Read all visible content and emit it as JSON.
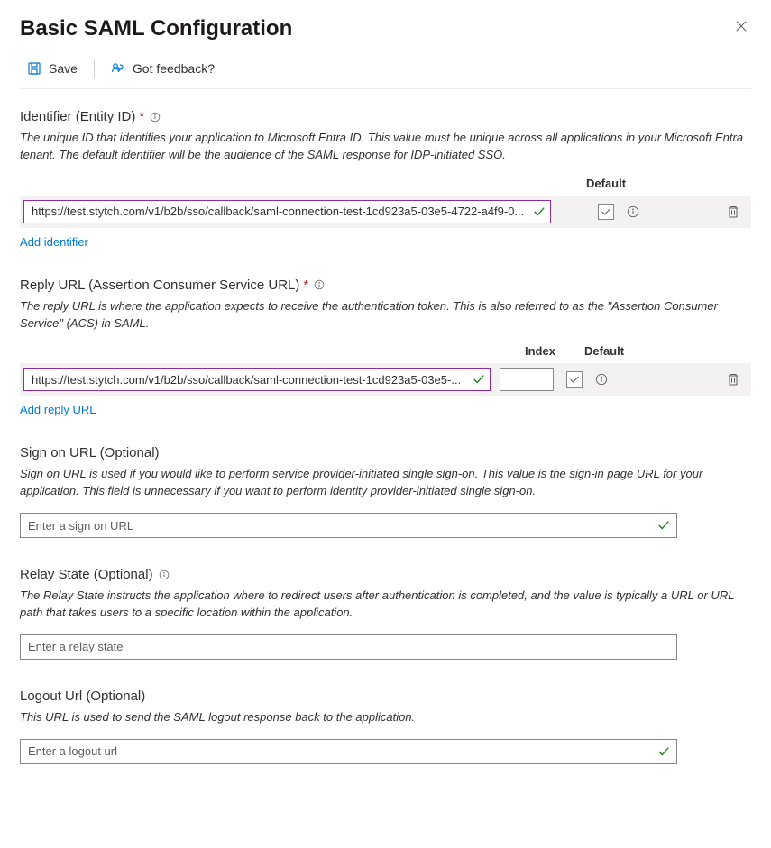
{
  "header": {
    "title": "Basic SAML Configuration"
  },
  "toolbar": {
    "save_label": "Save",
    "feedback_label": "Got feedback?"
  },
  "columns": {
    "index": "Index",
    "default": "Default"
  },
  "identifier": {
    "label": "Identifier (Entity ID)",
    "required_marker": "*",
    "description": "The unique ID that identifies your application to Microsoft Entra ID. This value must be unique across all applications in your Microsoft Entra tenant. The default identifier will be the audience of the SAML response for IDP-initiated SSO.",
    "value": "https://test.stytch.com/v1/b2b/sso/callback/saml-connection-test-1cd923a5-03e5-4722-a4f9-0...",
    "add_link": "Add identifier"
  },
  "reply_url": {
    "label": "Reply URL (Assertion Consumer Service URL)",
    "required_marker": "*",
    "description": "The reply URL is where the application expects to receive the authentication token. This is also referred to as the \"Assertion Consumer Service\" (ACS) in SAML.",
    "value": "https://test.stytch.com/v1/b2b/sso/callback/saml-connection-test-1cd923a5-03e5-...",
    "index_value": "",
    "add_link": "Add reply URL"
  },
  "sign_on": {
    "label": "Sign on URL (Optional)",
    "description": "Sign on URL is used if you would like to perform service provider-initiated single sign-on. This value is the sign-in page URL for your application. This field is unnecessary if you want to perform identity provider-initiated single sign-on.",
    "placeholder": "Enter a sign on URL"
  },
  "relay_state": {
    "label": "Relay State (Optional)",
    "description": "The Relay State instructs the application where to redirect users after authentication is completed, and the value is typically a URL or URL path that takes users to a specific location within the application.",
    "placeholder": "Enter a relay state"
  },
  "logout": {
    "label": "Logout Url (Optional)",
    "description": "This URL is used to send the SAML logout response back to the application.",
    "placeholder": "Enter a logout url"
  }
}
